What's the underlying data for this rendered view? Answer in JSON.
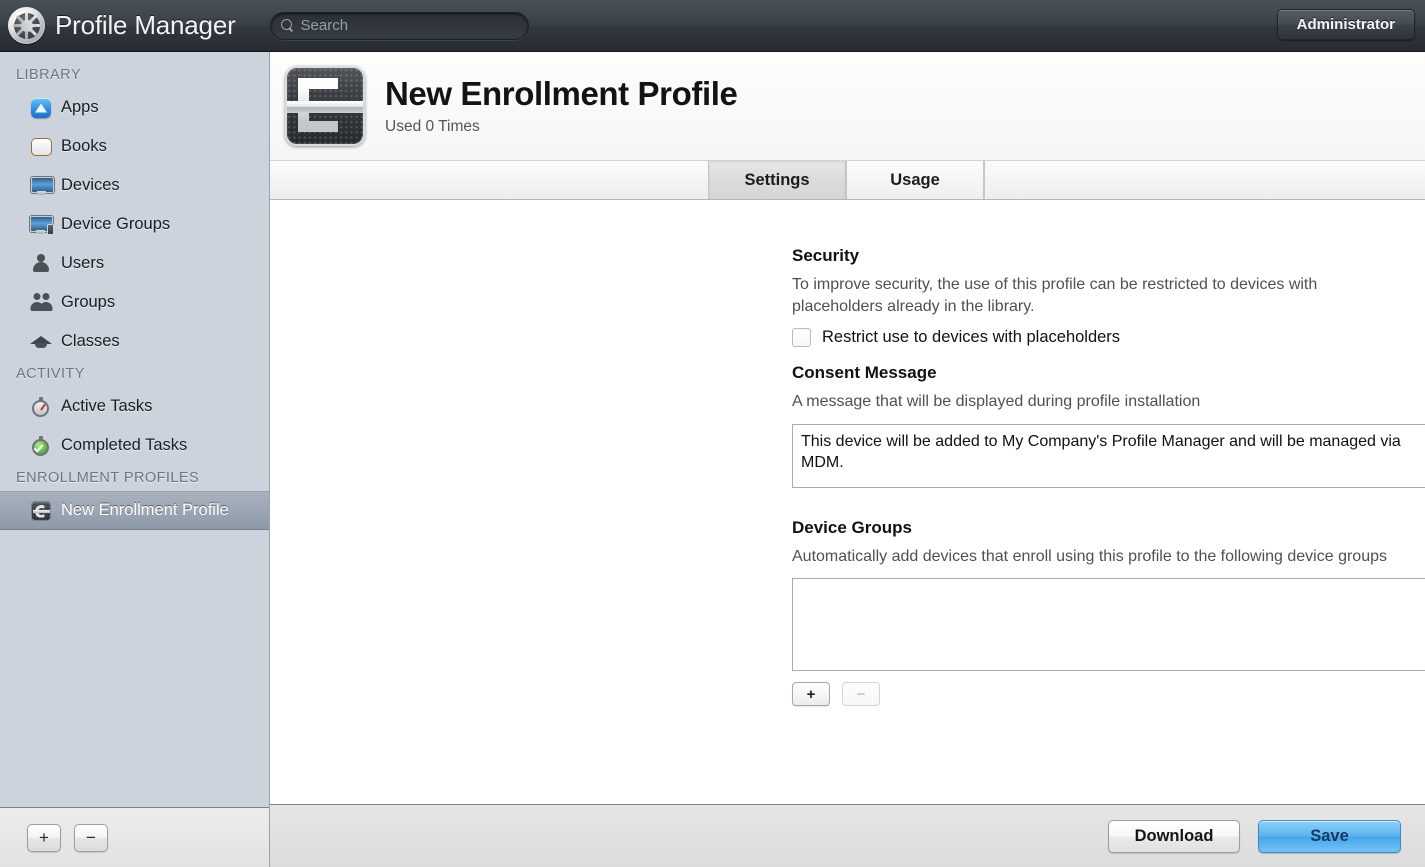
{
  "topbar": {
    "logo_icon": "gear-logo-icon",
    "app_title": "Profile Manager",
    "search": {
      "icon": "search-icon",
      "placeholder": "Search",
      "value": ""
    },
    "account_button": "Administrator"
  },
  "sidebar": {
    "sections": [
      {
        "label": "LIBRARY",
        "items": [
          {
            "label": "Apps",
            "icon": "apps-icon",
            "selected": false
          },
          {
            "label": "Books",
            "icon": "book-icon",
            "selected": false
          },
          {
            "label": "Devices",
            "icon": "display-icon",
            "selected": false
          },
          {
            "label": "Device Groups",
            "icon": "display-group-icon",
            "selected": false
          },
          {
            "label": "Users",
            "icon": "user-icon",
            "selected": false
          },
          {
            "label": "Groups",
            "icon": "users-group-icon",
            "selected": false
          },
          {
            "label": "Classes",
            "icon": "graduation-cap-icon",
            "selected": false
          }
        ]
      },
      {
        "label": "ACTIVITY",
        "items": [
          {
            "label": "Active Tasks",
            "icon": "stopwatch-icon",
            "selected": false
          },
          {
            "label": "Completed Tasks",
            "icon": "stopwatch-check-icon",
            "selected": false
          }
        ]
      },
      {
        "label": "ENROLLMENT PROFILES",
        "items": [
          {
            "label": "New Enrollment Profile",
            "icon": "profile-icon",
            "selected": true
          }
        ]
      }
    ],
    "footer": {
      "add_label": "+",
      "remove_label": "−"
    }
  },
  "main": {
    "header": {
      "icon": "enrollment-profile-icon",
      "title": "New Enrollment Profile",
      "subtitle": "Used 0 Times"
    },
    "tabs": [
      {
        "label": "Settings",
        "active": true
      },
      {
        "label": "Usage",
        "active": false
      }
    ],
    "settings": {
      "security": {
        "heading": "Security",
        "description": "To improve security, the use of this profile can be restricted to devices with placeholders already in the library.",
        "checkbox_label": "Restrict use to devices with placeholders",
        "checkbox_checked": false
      },
      "consent": {
        "heading": "Consent Message",
        "description": "A message that will be displayed during profile installation",
        "value": "This device will be added to My Company's Profile Manager and will be managed via MDM."
      },
      "device_groups": {
        "heading": "Device Groups",
        "description": "Automatically add devices that enroll using this profile to the following device groups",
        "items": [],
        "add_label": "+",
        "remove_label": "−"
      }
    }
  },
  "bottombar": {
    "download_label": "Download",
    "save_label": "Save"
  },
  "colors": {
    "topbar_dark": "#3a4047",
    "sidebar_bg": "#ccd3dd",
    "selection_blue_gray": "#8e99a8",
    "primary_button_blue": "#5cb3ef",
    "content_bg": "#ffffff"
  }
}
